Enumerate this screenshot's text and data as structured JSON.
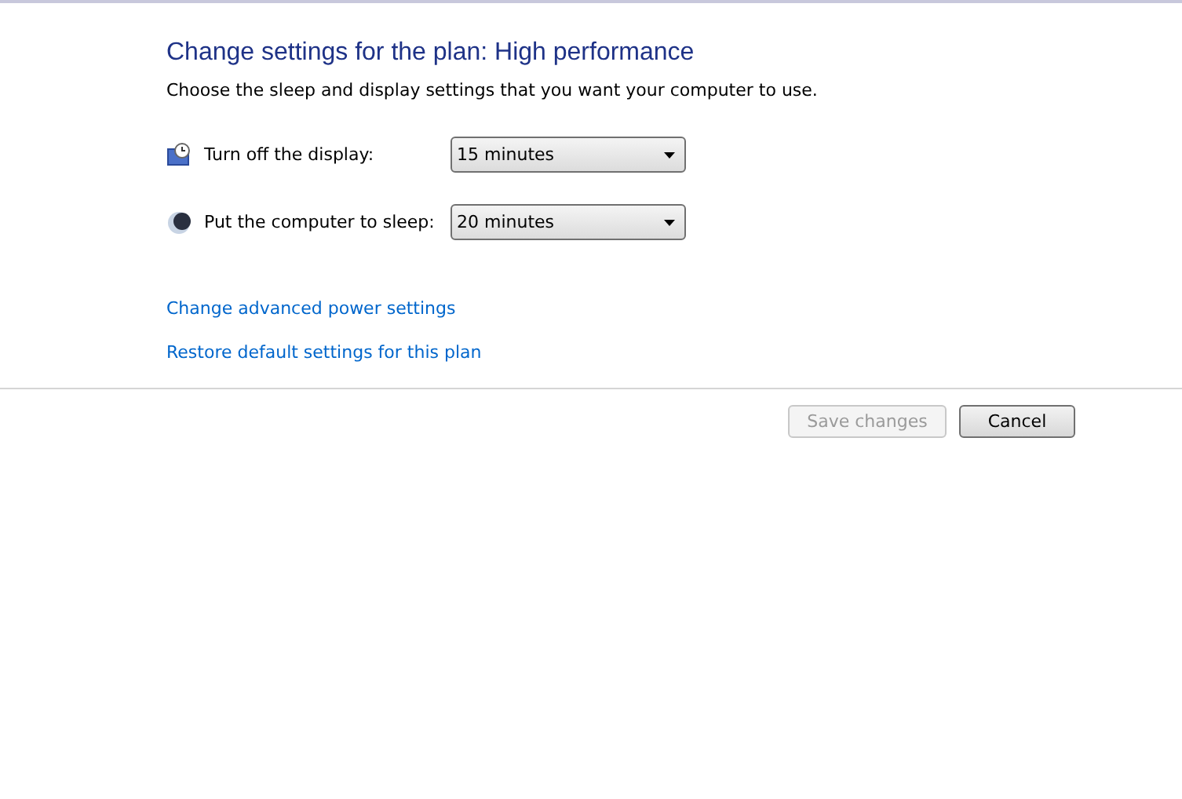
{
  "title": "Change settings for the plan: High performance",
  "subtitle": "Choose the sleep and display settings that you want your computer to use.",
  "settings": [
    {
      "kind": "display",
      "label": "Turn off the display:",
      "value": "15 minutes"
    },
    {
      "kind": "sleep",
      "label": "Put the computer to sleep:",
      "value": "20 minutes"
    }
  ],
  "links": [
    "Change advanced power settings",
    "Restore default settings for this plan"
  ],
  "buttons": [
    {
      "label": "Save changes",
      "disabled": true
    },
    {
      "label": "Cancel",
      "disabled": false
    }
  ]
}
